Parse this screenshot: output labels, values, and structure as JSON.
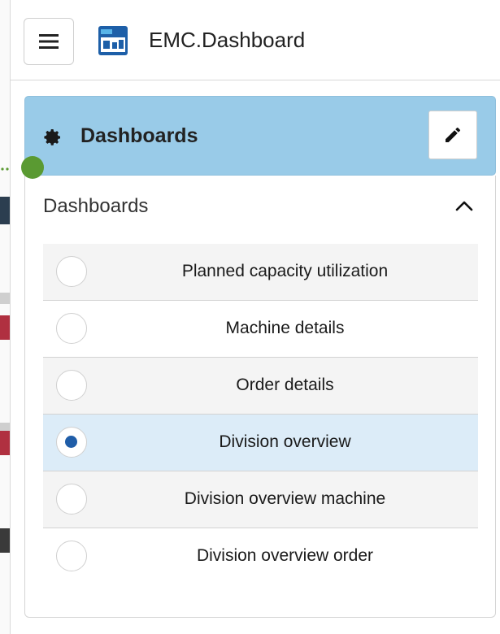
{
  "app": {
    "title": "EMC.Dashboard",
    "logo_icon": "emc-logo-icon"
  },
  "toolbar": {
    "menu_icon": "hamburger-menu-icon"
  },
  "dashboards_panel": {
    "header_title": "Dashboards",
    "header_icon": "gear-icon",
    "edit_icon": "pencil-icon",
    "section_title": "Dashboards",
    "collapse_icon": "chevron-up-icon",
    "items": [
      {
        "label": "Planned capacity utilization",
        "selected": false
      },
      {
        "label": "Machine details",
        "selected": false
      },
      {
        "label": "Order details",
        "selected": false
      },
      {
        "label": "Division overview",
        "selected": true
      },
      {
        "label": "Division overview machine",
        "selected": false
      },
      {
        "label": "Division overview order",
        "selected": false
      }
    ]
  },
  "colors": {
    "header_bg": "#99cbe8",
    "selected_row_bg": "#dcecf8",
    "radio_checked": "#1f5da8",
    "callout_dot": "#5a9a32"
  }
}
